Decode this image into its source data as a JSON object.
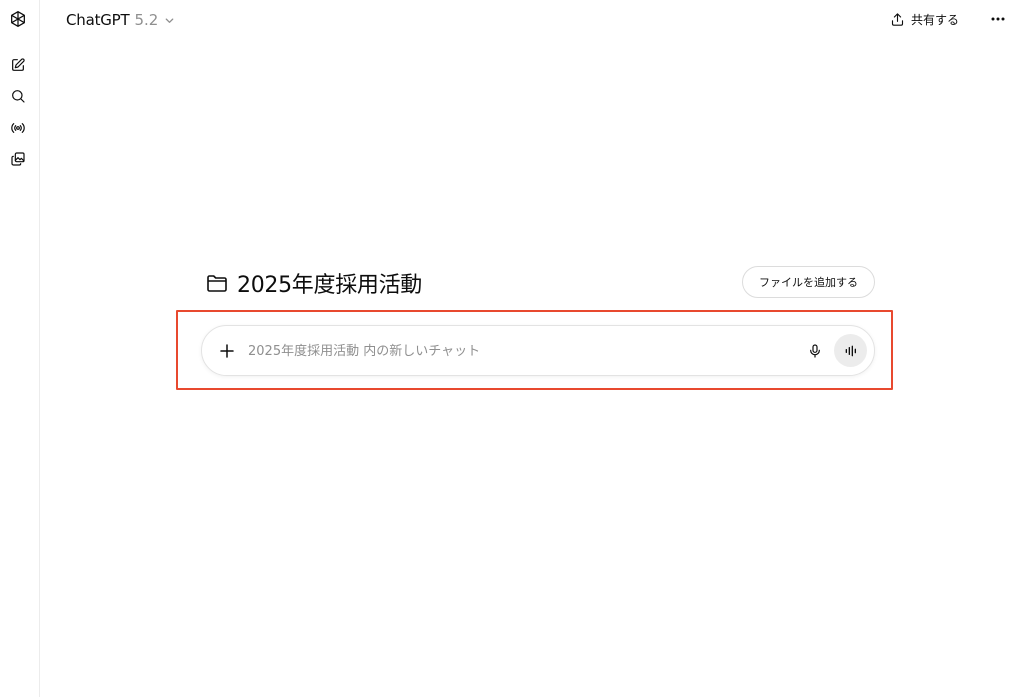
{
  "header": {
    "model_name": "ChatGPT",
    "model_version": "5.2",
    "share_label": "共有する"
  },
  "sidebar": {
    "icons": [
      "openai-logo-icon",
      "new-chat-icon",
      "search-icon",
      "live-icon",
      "library-icon"
    ]
  },
  "project": {
    "name": "2025年度採用活動",
    "add_file_label": "ファイルを追加する"
  },
  "composer": {
    "placeholder": "2025年度採用活動 内の新しいチャット",
    "value": ""
  },
  "colors": {
    "highlight": "#e8492f",
    "voice_button_bg": "#ececec",
    "placeholder": "#8f8f8f"
  }
}
